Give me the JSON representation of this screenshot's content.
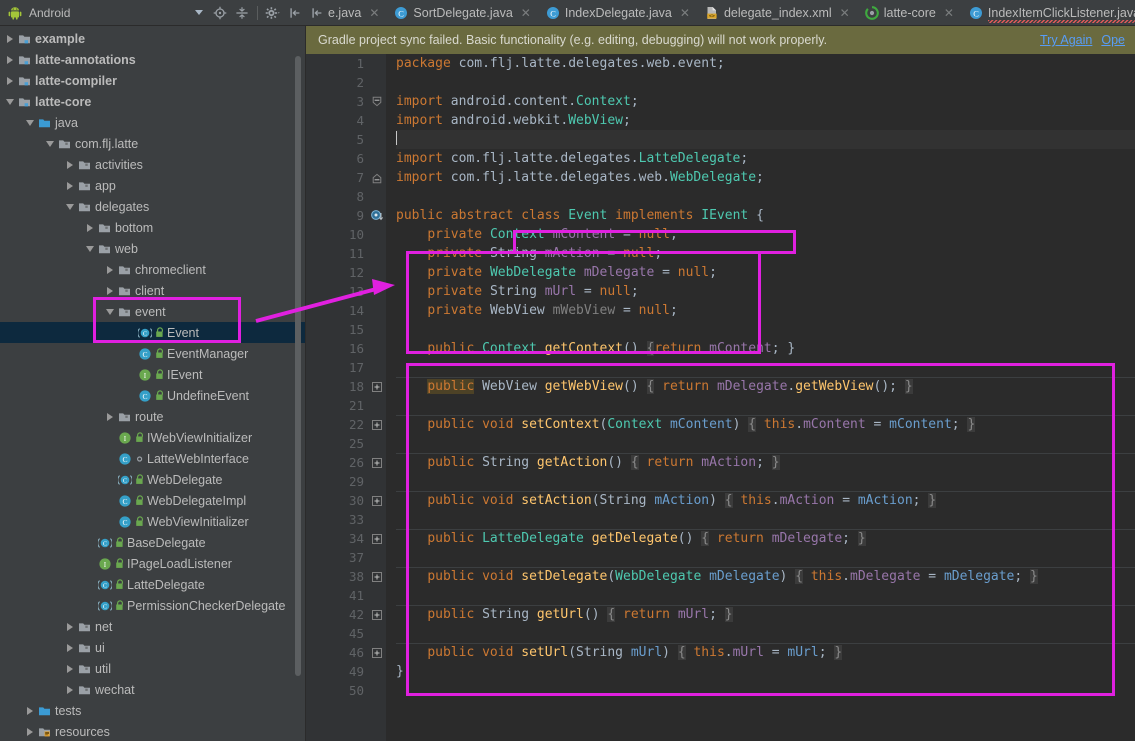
{
  "window": {
    "project_selector": "Android",
    "toolbar_icons": [
      "locate-icon",
      "collapse-all-icon",
      "settings-icon",
      "hide-panel-icon"
    ]
  },
  "tabs": [
    {
      "label": "e.java",
      "icon": "partial-tab",
      "closable": true,
      "error": false,
      "partial": true
    },
    {
      "label": "SortDelegate.java",
      "icon": "java-class-icon",
      "closable": true,
      "error": false,
      "partial": false
    },
    {
      "label": "IndexDelegate.java",
      "icon": "java-class-icon",
      "closable": true,
      "error": false,
      "partial": false
    },
    {
      "label": "delegate_index.xml",
      "icon": "xml-file-icon",
      "closable": true,
      "error": false,
      "partial": false
    },
    {
      "label": "latte-core",
      "icon": "gradle-icon",
      "closable": true,
      "error": false,
      "partial": false
    },
    {
      "label": "IndexItemClickListener.java",
      "icon": "java-class-icon",
      "closable": false,
      "error": true,
      "partial": false
    }
  ],
  "notification": {
    "message": "Gradle project sync failed. Basic functionality (e.g. editing, debugging) will not work properly.",
    "links": [
      "Try Again",
      "Ope"
    ],
    "background": "#6a6a3f"
  },
  "sidebar": {
    "nodes": [
      {
        "label": "example",
        "indent": 0,
        "arrow": "right",
        "icon": "module-folder-icon",
        "bold": true,
        "mark": "none",
        "selected": false
      },
      {
        "label": "latte-annotations",
        "indent": 0,
        "arrow": "right",
        "icon": "module-folder-icon",
        "bold": true,
        "mark": "none",
        "selected": false
      },
      {
        "label": "latte-compiler",
        "indent": 0,
        "arrow": "right",
        "icon": "module-folder-icon",
        "bold": true,
        "mark": "none",
        "selected": false
      },
      {
        "label": "latte-core",
        "indent": 0,
        "arrow": "down",
        "icon": "module-folder-icon",
        "bold": true,
        "mark": "none",
        "selected": false
      },
      {
        "label": "java",
        "indent": 1,
        "arrow": "down",
        "icon": "source-folder-icon",
        "bold": false,
        "mark": "none",
        "selected": false
      },
      {
        "label": "com.flj.latte",
        "indent": 2,
        "arrow": "down",
        "icon": "package-icon",
        "bold": false,
        "mark": "none",
        "selected": false
      },
      {
        "label": "activities",
        "indent": 3,
        "arrow": "right",
        "icon": "package-icon",
        "bold": false,
        "mark": "none",
        "selected": false
      },
      {
        "label": "app",
        "indent": 3,
        "arrow": "right",
        "icon": "package-icon",
        "bold": false,
        "mark": "none",
        "selected": false
      },
      {
        "label": "delegates",
        "indent": 3,
        "arrow": "down",
        "icon": "package-icon",
        "bold": false,
        "mark": "none",
        "selected": false
      },
      {
        "label": "bottom",
        "indent": 4,
        "arrow": "right",
        "icon": "package-icon",
        "bold": false,
        "mark": "none",
        "selected": false
      },
      {
        "label": "web",
        "indent": 4,
        "arrow": "down",
        "icon": "package-icon",
        "bold": false,
        "mark": "none",
        "selected": false
      },
      {
        "label": "chromeclient",
        "indent": 5,
        "arrow": "right",
        "icon": "package-icon",
        "bold": false,
        "mark": "none",
        "selected": false
      },
      {
        "label": "client",
        "indent": 5,
        "arrow": "right",
        "icon": "package-icon",
        "bold": false,
        "mark": "none",
        "selected": false
      },
      {
        "label": "event",
        "indent": 5,
        "arrow": "down",
        "icon": "package-icon",
        "bold": false,
        "mark": "none",
        "selected": false
      },
      {
        "label": "Event",
        "indent": 6,
        "arrow": "none",
        "icon": "abstract-class-icon",
        "bold": false,
        "mark": "lock",
        "selected": true
      },
      {
        "label": "EventManager",
        "indent": 6,
        "arrow": "none",
        "icon": "class-icon",
        "bold": false,
        "mark": "lock",
        "selected": false
      },
      {
        "label": "IEvent",
        "indent": 6,
        "arrow": "none",
        "icon": "interface-icon",
        "bold": false,
        "mark": "lock",
        "selected": false
      },
      {
        "label": "UndefineEvent",
        "indent": 6,
        "arrow": "none",
        "icon": "class-icon",
        "bold": false,
        "mark": "lock",
        "selected": false
      },
      {
        "label": "route",
        "indent": 5,
        "arrow": "right",
        "icon": "package-icon",
        "bold": false,
        "mark": "none",
        "selected": false
      },
      {
        "label": "IWebViewInitializer",
        "indent": 5,
        "arrow": "none",
        "icon": "interface-icon",
        "bold": false,
        "mark": "lock",
        "selected": false
      },
      {
        "label": "LatteWebInterface",
        "indent": 5,
        "arrow": "none",
        "icon": "class-icon",
        "bold": false,
        "mark": "dot",
        "selected": false
      },
      {
        "label": "WebDelegate",
        "indent": 5,
        "arrow": "none",
        "icon": "abstract-class-icon",
        "bold": false,
        "mark": "lock",
        "selected": false
      },
      {
        "label": "WebDelegateImpl",
        "indent": 5,
        "arrow": "none",
        "icon": "class-icon",
        "bold": false,
        "mark": "lock",
        "selected": false
      },
      {
        "label": "WebViewInitializer",
        "indent": 5,
        "arrow": "none",
        "icon": "class-icon",
        "bold": false,
        "mark": "lock",
        "selected": false
      },
      {
        "label": "BaseDelegate",
        "indent": 4,
        "arrow": "none",
        "icon": "abstract-class-icon",
        "bold": false,
        "mark": "lock",
        "selected": false
      },
      {
        "label": "IPageLoadListener",
        "indent": 4,
        "arrow": "none",
        "icon": "interface-icon",
        "bold": false,
        "mark": "lock",
        "selected": false
      },
      {
        "label": "LatteDelegate",
        "indent": 4,
        "arrow": "none",
        "icon": "abstract-class-icon",
        "bold": false,
        "mark": "lock",
        "selected": false
      },
      {
        "label": "PermissionCheckerDelegate",
        "indent": 4,
        "arrow": "none",
        "icon": "abstract-class-icon",
        "bold": false,
        "mark": "lock",
        "selected": false
      },
      {
        "label": "net",
        "indent": 3,
        "arrow": "right",
        "icon": "package-icon",
        "bold": false,
        "mark": "none",
        "selected": false
      },
      {
        "label": "ui",
        "indent": 3,
        "arrow": "right",
        "icon": "package-icon",
        "bold": false,
        "mark": "none",
        "selected": false
      },
      {
        "label": "util",
        "indent": 3,
        "arrow": "right",
        "icon": "package-icon",
        "bold": false,
        "mark": "none",
        "selected": false
      },
      {
        "label": "wechat",
        "indent": 3,
        "arrow": "right",
        "icon": "package-icon",
        "bold": false,
        "mark": "none",
        "selected": false
      },
      {
        "label": "tests",
        "indent": 1,
        "arrow": "right",
        "icon": "test-folder-icon",
        "bold": false,
        "mark": "none",
        "selected": false
      },
      {
        "label": "resources",
        "indent": 1,
        "arrow": "right",
        "icon": "resources-folder-icon",
        "bold": false,
        "mark": "none",
        "selected": false
      }
    ]
  },
  "editor": {
    "file_language": "java",
    "gutter_numbers": [
      "1",
      "2",
      "3",
      "4",
      "5",
      "6",
      "7",
      "8",
      "9",
      "10",
      "11",
      "12",
      "13",
      "14",
      "15",
      "16",
      "17",
      "18",
      "21",
      "22",
      "25",
      "26",
      "29",
      "30",
      "33",
      "34",
      "37",
      "38",
      "41",
      "42",
      "45",
      "46",
      "49",
      "50"
    ],
    "current_line_number": "5",
    "code_lines": [
      "package com.flj.latte.delegates.web.event;",
      "",
      "import android.content.Context;",
      "import android.webkit.WebView;",
      "",
      "import com.flj.latte.delegates.LatteDelegate;",
      "import com.flj.latte.delegates.web.WebDelegate;",
      "",
      "public abstract class Event implements IEvent {",
      "    private Context mContent = null;",
      "    private String mAction = null;",
      "    private WebDelegate mDelegate = null;",
      "    private String mUrl = null;",
      "    private WebView mWebView = null;",
      "",
      "    public Context getContext() {return mContent; }",
      "",
      "    public WebView getWebView() { return mDelegate.getWebView(); }",
      "",
      "    public void setContext(Context mContent) { this.mContent = mContent; }",
      "",
      "    public String getAction() { return mAction; }",
      "",
      "    public void setAction(String mAction) { this.mAction = mAction; }",
      "",
      "    public LatteDelegate getDelegate() { return mDelegate; }",
      "",
      "    public void setDelegate(WebDelegate mDelegate) { this.mDelegate = mDelegate; }",
      "",
      "    public String getUrl() { return mUrl; }",
      "",
      "    public void setUrl(String mUrl) { this.mUrl = mUrl; }",
      "}",
      ""
    ]
  },
  "annotations": {
    "color": "#e020e0",
    "boxes": [
      {
        "name": "event-folder-box"
      },
      {
        "name": "class-declaration-box"
      },
      {
        "name": "fields-box"
      },
      {
        "name": "methods-box"
      }
    ],
    "arrow": {
      "name": "sidebar-to-fields-arrow"
    }
  }
}
